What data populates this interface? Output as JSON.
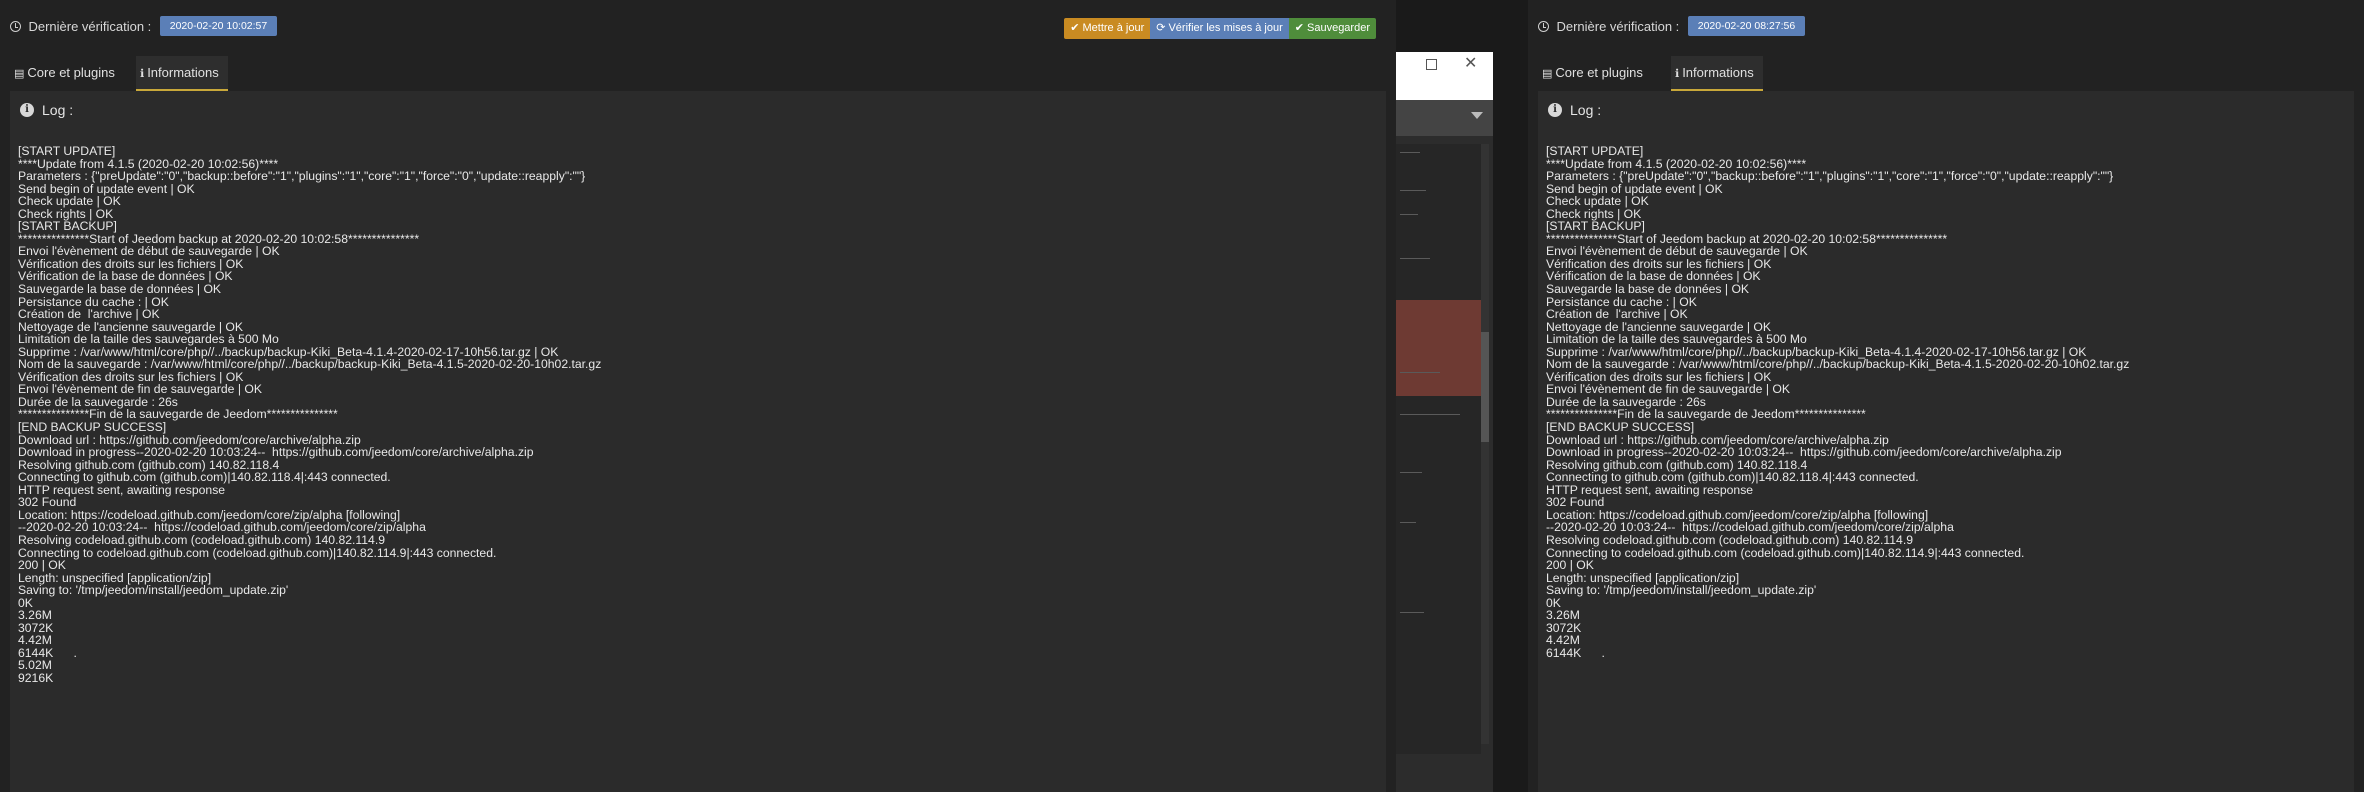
{
  "left_panel": {
    "header": {
      "last_check_label": "Dernière vérification :",
      "last_check_value": "2020-02-20 10:02:57"
    },
    "buttons": {
      "update": "Mettre à jour",
      "check_updates": "Vérifier les mises à jour",
      "save": "Sauvegarder"
    },
    "tabs": [
      {
        "label": "Core et plugins"
      },
      {
        "label": "Informations"
      }
    ],
    "log_title": "Log :",
    "log_lines": [
      "[START UPDATE]",
      "****Update from 4.1.5 (2020-02-20 10:02:56)****",
      "Parameters : {\"preUpdate\":\"0\",\"backup::before\":\"1\",\"plugins\":\"1\",\"core\":\"1\",\"force\":\"0\",\"update::reapply\":\"\"}",
      "Send begin of update event | OK",
      "Check update | OK",
      "Check rights | OK",
      "[START BACKUP]",
      "***************Start of Jeedom backup at 2020-02-20 10:02:58***************",
      "Envoi l'évènement de début de sauvegarde | OK",
      "Vérification des droits sur les fichiers | OK",
      "Vérification de la base de données | OK",
      "Sauvegarde la base de données | OK",
      "Persistance du cache : | OK",
      "Création de  l'archive | OK",
      "Nettoyage de l'ancienne sauvegarde | OK",
      "Limitation de la taille des sauvegardes à 500 Mo",
      "Supprime : /var/www/html/core/php//../backup/backup-Kiki_Beta-4.1.4-2020-02-17-10h56.tar.gz | OK",
      "Nom de la sauvegarde : /var/www/html/core/php//../backup/backup-Kiki_Beta-4.1.5-2020-02-20-10h02.tar.gz",
      "Vérification des droits sur les fichiers | OK",
      "Envoi l'évènement de fin de sauvegarde | OK",
      "Durée de la sauvegarde : 26s",
      "***************Fin de la sauvegarde de Jeedom***************",
      "[END BACKUP SUCCESS]",
      "Download url : https://github.com/jeedom/core/archive/alpha.zip",
      "Download in progress--2020-02-20 10:03:24--  https://github.com/jeedom/core/archive/alpha.zip",
      "Resolving github.com (github.com) 140.82.118.4",
      "Connecting to github.com (github.com)|140.82.118.4|:443 connected.",
      "HTTP request sent, awaiting response",
      "302 Found",
      "Location: https://codeload.github.com/jeedom/core/zip/alpha [following]",
      "--2020-02-20 10:03:24--  https://codeload.github.com/jeedom/core/zip/alpha",
      "Resolving codeload.github.com (codeload.github.com) 140.82.114.9",
      "Connecting to codeload.github.com (codeload.github.com)|140.82.114.9|:443 connected.",
      "200 | OK",
      "Length: unspecified [application/zip]",
      "Saving to: '/tmp/jeedom/install/jeedom_update.zip'",
      "0K",
      "3.26M",
      "3072K",
      "4.42M",
      "6144K      .",
      "5.02M",
      "9216K"
    ]
  },
  "right_panel": {
    "header": {
      "last_check_label": "Dernière vérification :",
      "last_check_value": "2020-02-20 08:27:56"
    },
    "tabs": [
      {
        "label": "Core et plugins"
      },
      {
        "label": "Informations"
      }
    ],
    "log_title": "Log :",
    "log_lines": [
      "[START UPDATE]",
      "****Update from 4.1.5 (2020-02-20 10:02:56)****",
      "Parameters : {\"preUpdate\":\"0\",\"backup::before\":\"1\",\"plugins\":\"1\",\"core\":\"1\",\"force\":\"0\",\"update::reapply\":\"\"}",
      "Send begin of update event | OK",
      "Check update | OK",
      "Check rights | OK",
      "[START BACKUP]",
      "***************Start of Jeedom backup at 2020-02-20 10:02:58***************",
      "Envoi l'évènement de début de sauvegarde | OK",
      "Vérification des droits sur les fichiers | OK",
      "Vérification de la base de données | OK",
      "Sauvegarde la base de données | OK",
      "Persistance du cache : | OK",
      "Création de  l'archive | OK",
      "Nettoyage de l'ancienne sauvegarde | OK",
      "Limitation de la taille des sauvegardes à 500 Mo",
      "Supprime : /var/www/html/core/php//../backup/backup-Kiki_Beta-4.1.4-2020-02-17-10h56.tar.gz | OK",
      "Nom de la sauvegarde : /var/www/html/core/php//../backup/backup-Kiki_Beta-4.1.5-2020-02-20-10h02.tar.gz",
      "Vérification des droits sur les fichiers | OK",
      "Envoi l'évènement de fin de sauvegarde | OK",
      "Durée de la sauvegarde : 26s",
      "***************Fin de la sauvegarde de Jeedom***************",
      "[END BACKUP SUCCESS]",
      "Download url : https://github.com/jeedom/core/archive/alpha.zip",
      "Download in progress--2020-02-20 10:03:24--  https://github.com/jeedom/core/archive/alpha.zip",
      "Resolving github.com (github.com) 140.82.118.4",
      "Connecting to github.com (github.com)|140.82.118.4|:443 connected.",
      "HTTP request sent, awaiting response",
      "302 Found",
      "Location: https://codeload.github.com/jeedom/core/zip/alpha [following]",
      "--2020-02-20 10:03:24--  https://codeload.github.com/jeedom/core/zip/alpha",
      "Resolving codeload.github.com (codeload.github.com) 140.82.114.9",
      "Connecting to codeload.github.com (codeload.github.com)|140.82.114.9|:443 connected.",
      "200 | OK",
      "Length: unspecified [application/zip]",
      "Saving to: '/tmp/jeedom/install/jeedom_update.zip'",
      "0K",
      "3.26M",
      "3072K",
      "4.42M",
      "6144K      ."
    ]
  },
  "icons": {
    "clock": "clock-icon",
    "check": "check-icon",
    "refresh": "refresh-icon",
    "save": "check-circle-icon",
    "archive": "archive-icon",
    "info": "info-icon"
  },
  "colors": {
    "background": "#222222",
    "content": "#2b2b2b",
    "badge": "#5b7fb7",
    "update_button": "#c98b22",
    "check_button": "#5b7fb7",
    "save_button": "#4f8d3b",
    "active_tab_border": "#c9a83a"
  }
}
